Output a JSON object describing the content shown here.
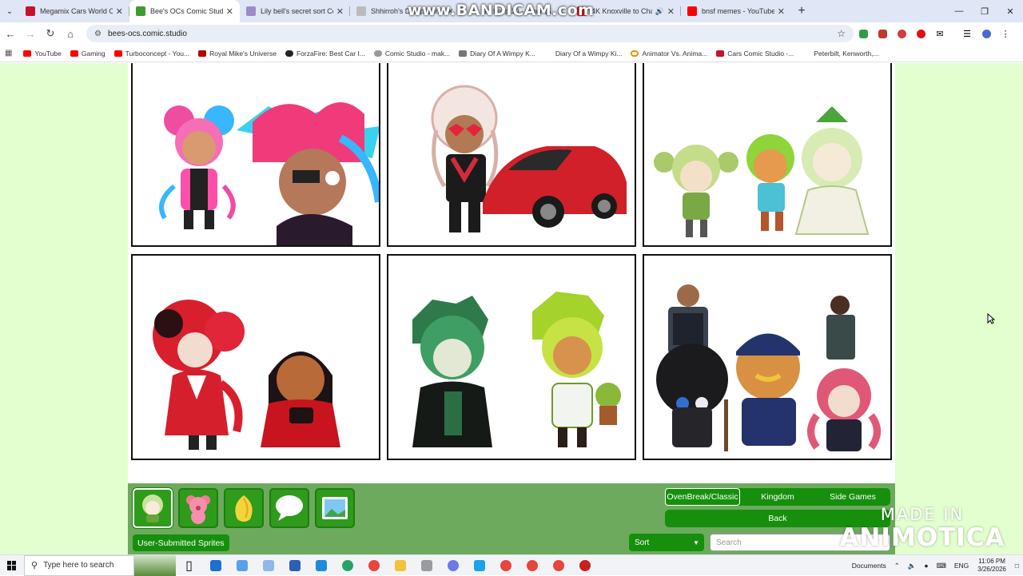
{
  "browser": {
    "recorder_watermark": "www.BANDICAM.com",
    "tabs": [
      {
        "title": "Megamix Cars World Con",
        "color": "#c8102e",
        "active": false,
        "audio": false
      },
      {
        "title": "Bee's OCs Comic Studio -",
        "color": "#3f9b2f",
        "active": true,
        "audio": false
      },
      {
        "title": "Lily bell's secret sort Com",
        "color": "#9a8cc8",
        "active": false,
        "audio": false
      },
      {
        "title": "Shhirroh's Dump Com",
        "color": "#bbbbbb",
        "active": false,
        "audio": false
      },
      {
        "title": "GA Loop 10 - Athens",
        "color": "#d8d8d8",
        "active": false,
        "audio": true
      },
      {
        "title": "4K Knoxville to Chatt",
        "color": "#ff0000",
        "active": false,
        "audio": true
      },
      {
        "title": "bnsf memes - YouTube",
        "color": "#ff0000",
        "active": false,
        "audio": false
      }
    ],
    "url": "bees-ocs.comic.studio",
    "bookmarks": [
      {
        "label": "YouTube",
        "color": "#ff0000"
      },
      {
        "label": "Gaming",
        "color": "#ff0000"
      },
      {
        "label": "Turboconcept - You...",
        "color": "#ff0000"
      },
      {
        "label": "Royal Mike's Universe",
        "color": "#b30000"
      },
      {
        "label": "ForzaFire: Best Car I...",
        "color": "#222222"
      },
      {
        "label": "Comic Studio - mak...",
        "color": "#999999"
      },
      {
        "label": "Diary Of A Wimpy K...",
        "color": "#777777"
      },
      {
        "label": "Diary Of a Wimpy Ki...",
        "color": "#ffffff"
      },
      {
        "label": "Animator Vs. Anima...",
        "color": "#e59400"
      },
      {
        "label": "Cars Comic Studio -...",
        "color": "#c8102e"
      },
      {
        "label": "Peterbilt, Kenworth,...",
        "color": "#ffffff"
      }
    ]
  },
  "page": {
    "colors": {
      "background": "#e3ffcf",
      "bar": "#6daa5e",
      "button": "#168f0c"
    },
    "panels": [
      {
        "id": "panel-1",
        "depicts": "pink and blue cookie characters"
      },
      {
        "id": "panel-2",
        "depicts": "cookie with heart sunglasses and red sports car"
      },
      {
        "id": "panel-3",
        "depicts": "three green cookie characters"
      },
      {
        "id": "panel-4",
        "depicts": "red-haired cookie and dark-haired cookie"
      },
      {
        "id": "panel-5",
        "depicts": "two green-leaf cookie characters"
      },
      {
        "id": "panel-6",
        "depicts": "officer cookies and characters"
      }
    ],
    "sprite_buttons": [
      {
        "icon": "green-cookie-icon",
        "selected": true
      },
      {
        "icon": "teddy-bear-icon",
        "selected": false
      },
      {
        "icon": "gold-leaf-icon",
        "selected": false
      },
      {
        "icon": "speech-bubble-icon",
        "selected": false
      },
      {
        "icon": "landscape-image-icon",
        "selected": false
      }
    ],
    "user_submitted_label": "User-Submitted Sprites",
    "categories": [
      "OvenBreak/Classic",
      "Kingdom",
      "Side Games"
    ],
    "selected_category": "OvenBreak/Classic",
    "back_label": "Back",
    "sort_label": "Sort",
    "search_placeholder": "Search"
  },
  "watermark": {
    "line1": "MADE IN",
    "line2": "ANIMOTICA"
  },
  "taskbar": {
    "search_placeholder": "Type here to search",
    "documents_label": "Documents",
    "language": "ENG",
    "time": "11:06 PM",
    "date": "3/26/2026"
  }
}
